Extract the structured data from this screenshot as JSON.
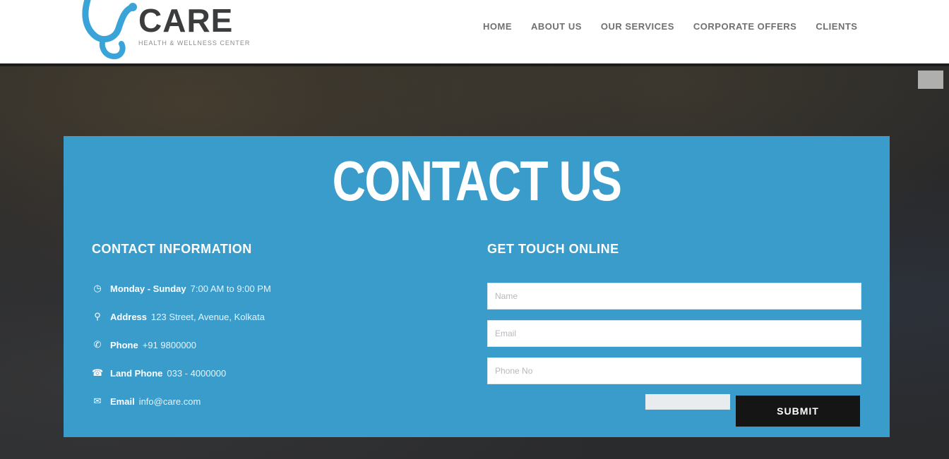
{
  "header": {
    "logo_text": "CARE",
    "logo_tagline": "HEALTH & WELLNESS CENTER",
    "nav": [
      {
        "label": "HOME"
      },
      {
        "label": "ABOUT US"
      },
      {
        "label": "OUR SERVICES"
      },
      {
        "label": "CORPORATE OFFERS"
      },
      {
        "label": "CLIENTS"
      }
    ]
  },
  "contact": {
    "title": "CONTACT US",
    "info_heading": "CONTACT INFORMATION",
    "form_heading": "GET TOUCH ONLINE",
    "info": [
      {
        "icon": "clock-icon",
        "glyph": "◷",
        "label": "Monday - Sunday",
        "value": "7:00 AM to 9:00 PM"
      },
      {
        "icon": "map-pin-icon",
        "glyph": "⚲",
        "label": "Address",
        "value": "123 Street, Avenue, Kolkata"
      },
      {
        "icon": "phone-icon",
        "glyph": "✆",
        "label": "Phone",
        "value": "+91 9800000"
      },
      {
        "icon": "landline-icon",
        "glyph": "☎",
        "label": "Land Phone",
        "value": "033 - 4000000"
      },
      {
        "icon": "email-icon",
        "glyph": "✉",
        "label": "Email",
        "value": "info@care.com"
      }
    ],
    "form": {
      "name_placeholder": "Name",
      "email_placeholder": "Email",
      "phone_placeholder": "Phone No",
      "captcha_text": "",
      "submit_label": "SUBMIT"
    }
  },
  "colors": {
    "panel": "#3a9ccb",
    "submit": "#151515",
    "logo_accent": "#3aa4d8"
  }
}
